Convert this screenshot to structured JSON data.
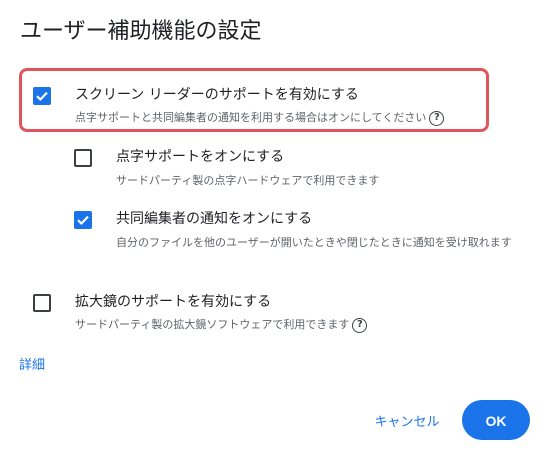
{
  "dialog": {
    "title": "ユーザー補助機能の設定",
    "options": [
      {
        "label": "スクリーン リーダーのサポートを有効にする",
        "description": "点字サポートと共同編集者の通知を利用する場合はオンにしてください",
        "checked": true,
        "help_icon": "help-circle-icon"
      },
      {
        "label": "点字サポートをオンにする",
        "description": "サードパーティ製の点字ハードウェアで利用できます",
        "checked": false
      },
      {
        "label": "共同編集者の通知をオンにする",
        "description": "自分のファイルを他のユーザーが開いたときや閉じたときに通知を受け取れます",
        "checked": true
      },
      {
        "label": "拡大鏡のサポートを有効にする",
        "description": "サードパーティ製の拡大鏡ソフトウェアで利用できます",
        "checked": false,
        "help_icon": "help-circle-icon"
      }
    ],
    "details_link": "詳細",
    "cancel_label": "キャンセル",
    "ok_label": "OK"
  },
  "colors": {
    "accent": "#1a73e8",
    "highlight_border": "#e0545b",
    "text_primary": "#202124",
    "text_secondary": "#5f6368"
  }
}
